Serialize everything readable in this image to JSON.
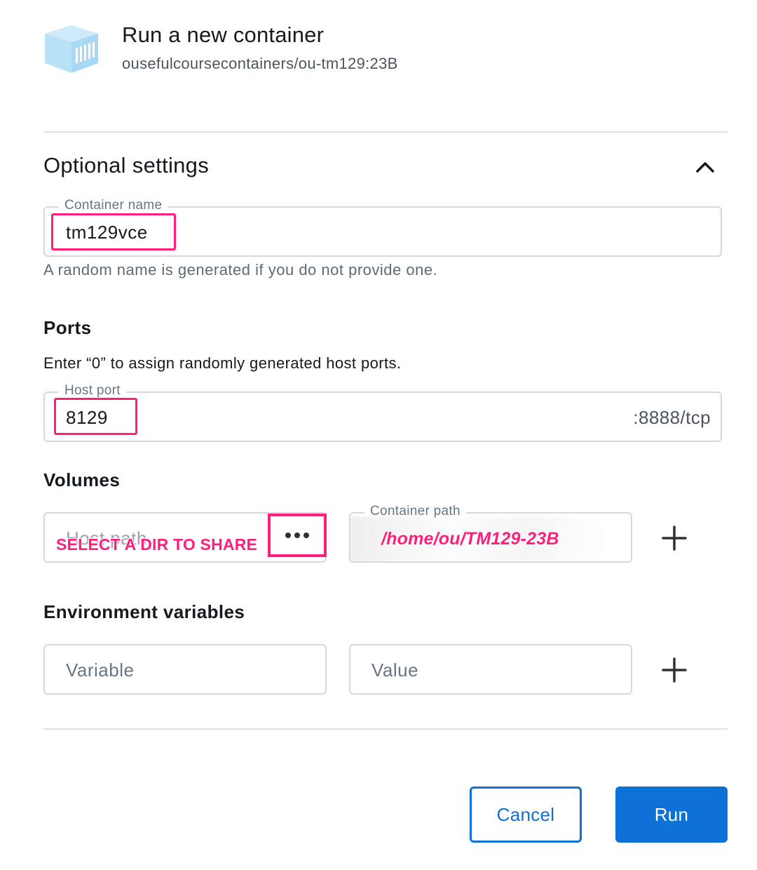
{
  "header": {
    "title": "Run a new container",
    "image_name": "ousefulcoursecontainers/ou-tm129:23B",
    "logo_icon": "container-icon",
    "logo_color": "#b3e0f7"
  },
  "optional_settings": {
    "title": "Optional settings",
    "toggle_icon": "chevron-up-icon"
  },
  "container_name": {
    "label": "Container name",
    "value": "tm129vce",
    "helper": "A random name is generated if you do not provide one."
  },
  "ports": {
    "title": "Ports",
    "description": "Enter “0” to assign randomly generated host ports.",
    "host_port_label": "Host port",
    "host_port_value": "8129",
    "container_port": ":8888/tcp"
  },
  "volumes": {
    "title": "Volumes",
    "host_path_placeholder": "Host path",
    "annotation": "SELECT A DIR TO SHARE",
    "browse_icon": "more-horizontal-icon",
    "container_path_label": "Container path",
    "container_path_annotation": "/home/ou/TM129-23B",
    "add_icon": "plus-icon"
  },
  "env": {
    "title": "Environment variables",
    "variable_placeholder": "Variable",
    "value_placeholder": "Value",
    "add_icon": "plus-icon"
  },
  "actions": {
    "cancel_label": "Cancel",
    "run_label": "Run"
  },
  "colors": {
    "primary": "#0d71d5",
    "annotation": "#ff1f7a"
  }
}
